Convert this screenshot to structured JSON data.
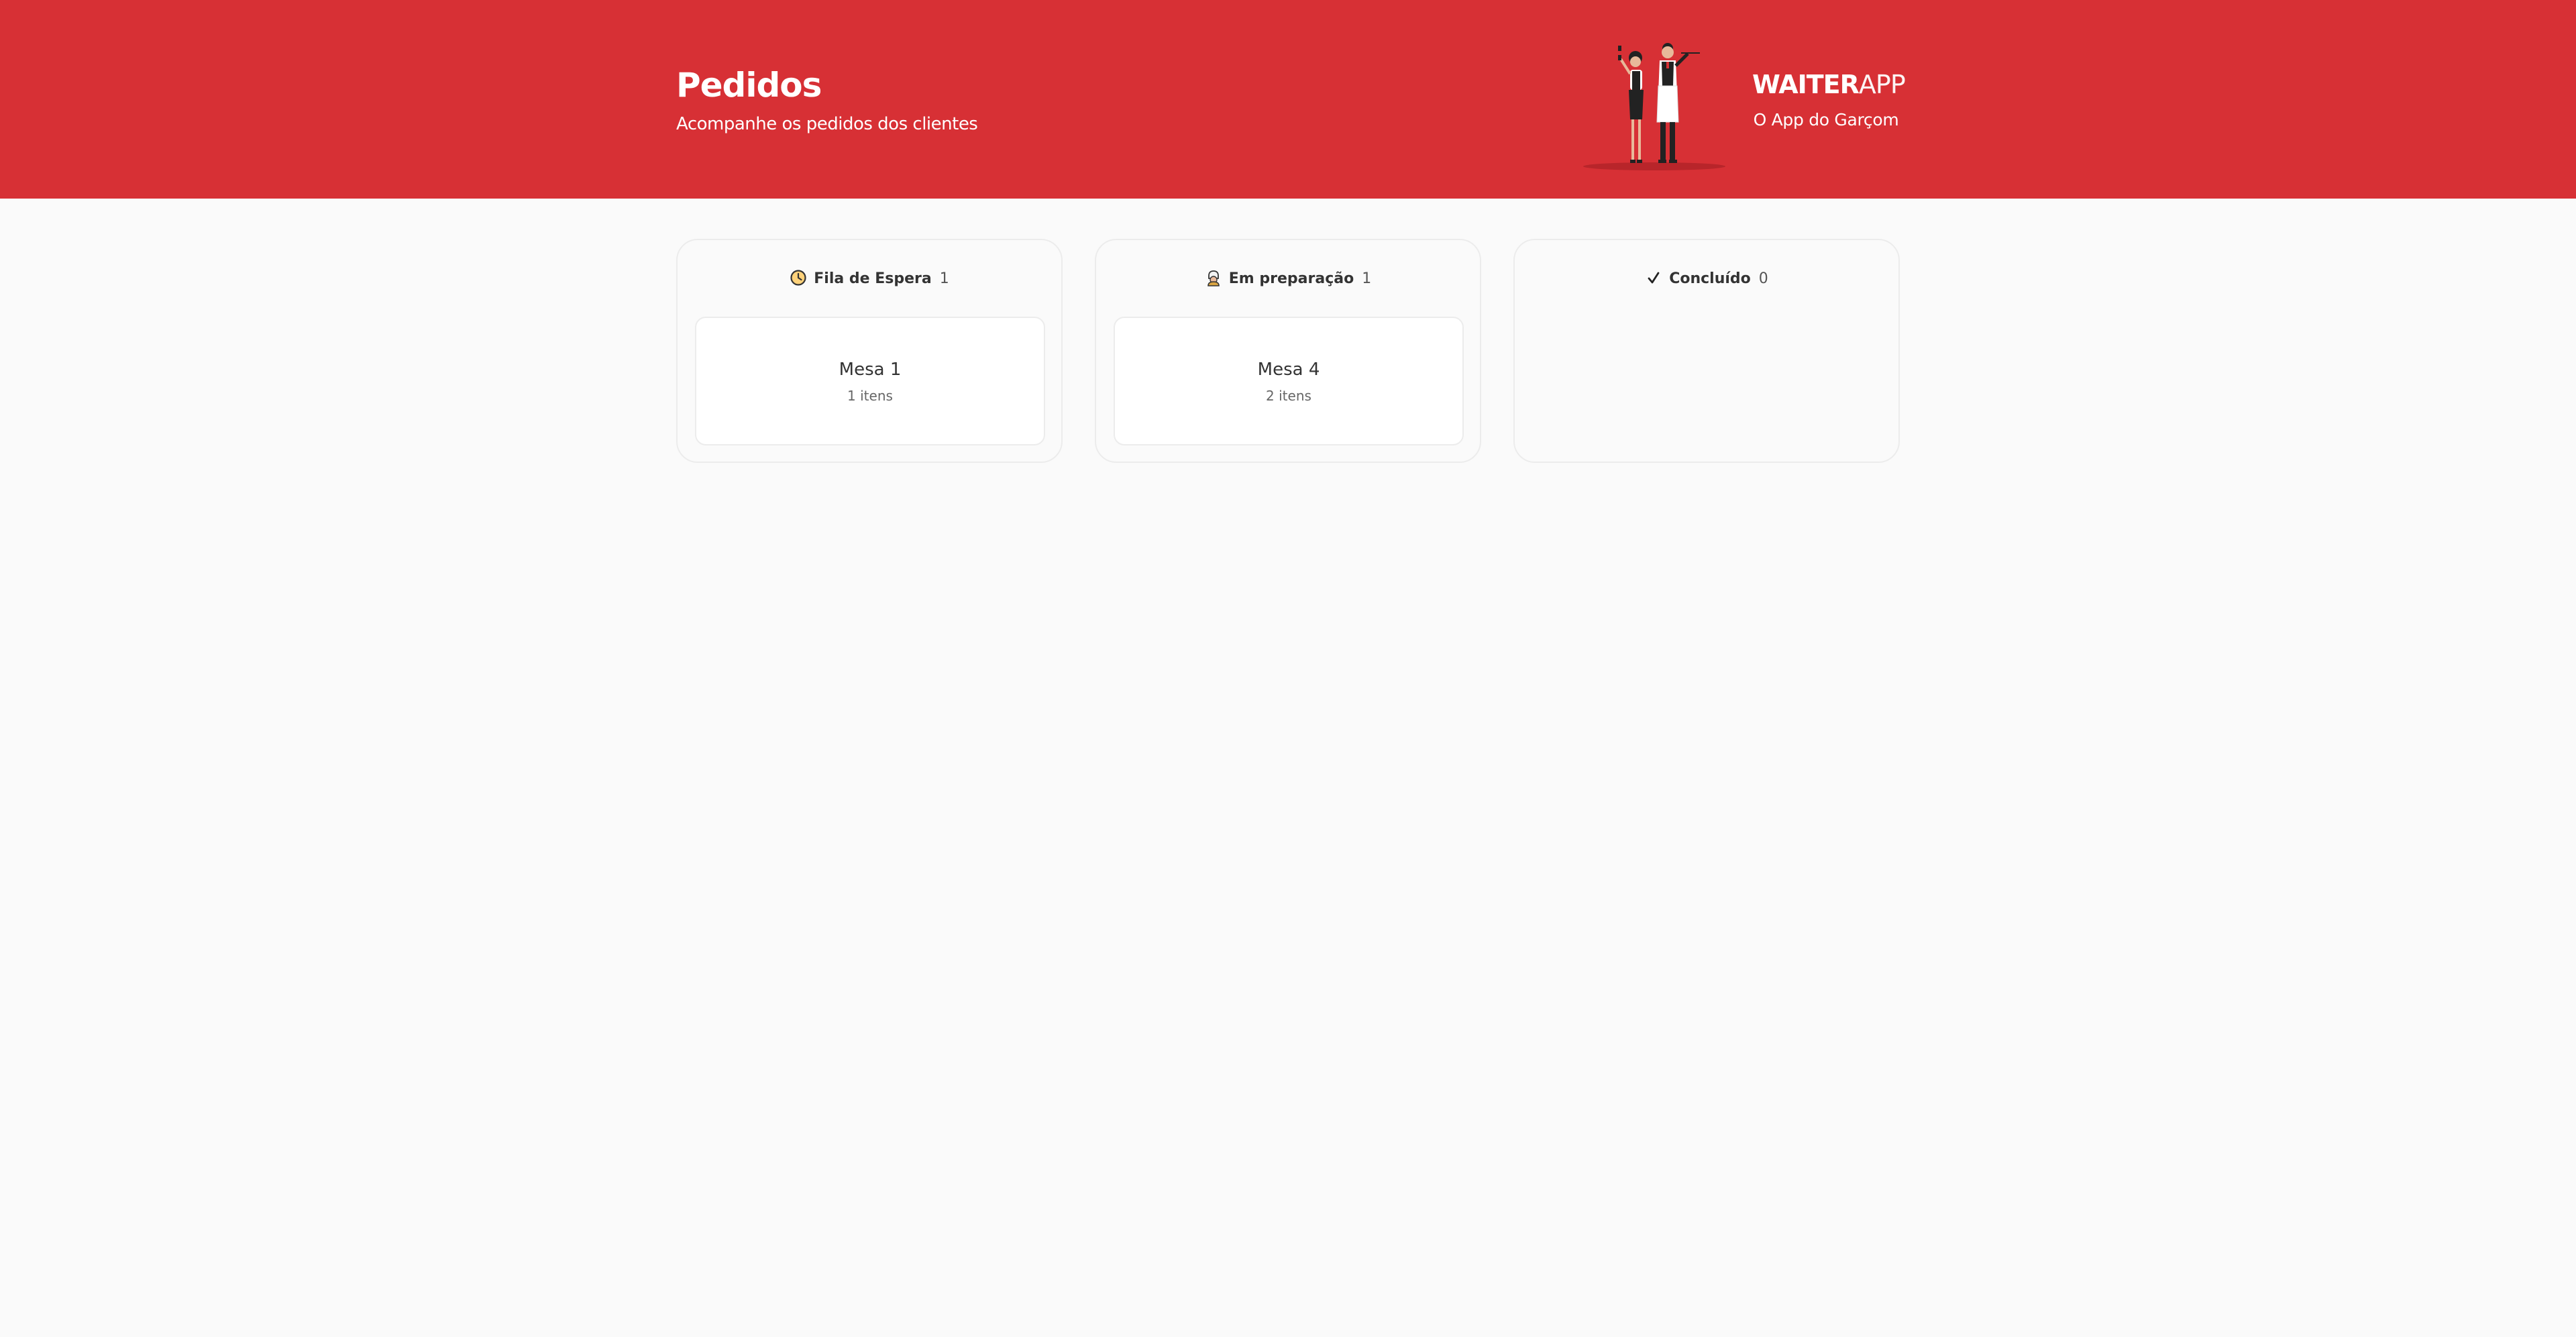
{
  "header": {
    "title": "Pedidos",
    "subtitle": "Acompanhe os pedidos dos clientes",
    "brand_bold": "WAITER",
    "brand_light": "APP",
    "brand_tagline": "O App do Garçom",
    "illustration_icon": "waiters-illustration"
  },
  "board": {
    "columns": [
      {
        "icon": "clock-icon",
        "label": "Fila de Espera",
        "count": "1",
        "orders": [
          {
            "table": "Mesa 1",
            "items": "1 itens"
          }
        ]
      },
      {
        "icon": "chef-icon",
        "label": "Em preparação",
        "count": "1",
        "orders": [
          {
            "table": "Mesa 4",
            "items": "2 itens"
          }
        ]
      },
      {
        "icon": "check-icon",
        "label": "Concluído",
        "count": "0",
        "orders": []
      }
    ]
  },
  "colors": {
    "brand_red": "#d73035",
    "background": "#fafafa",
    "card_border": "#ececec"
  }
}
